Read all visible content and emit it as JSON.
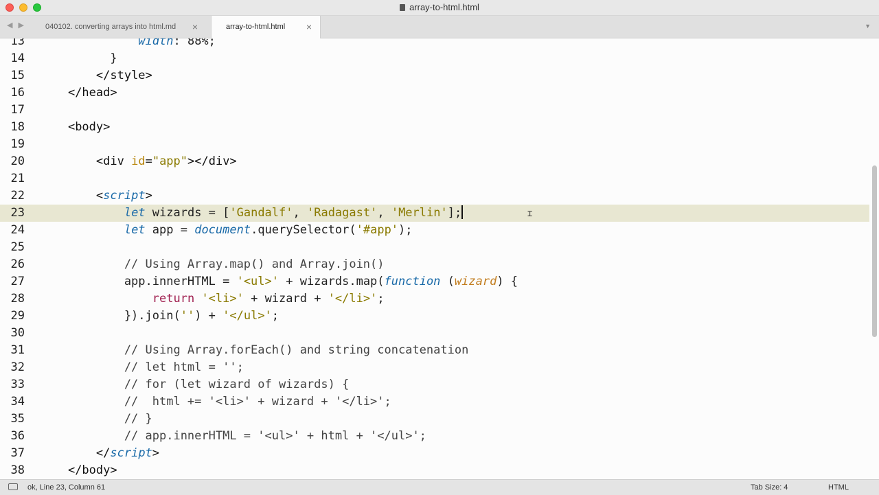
{
  "window": {
    "title": "array-to-html.html"
  },
  "tabs": [
    {
      "label": "040102. converting arrays into html.md",
      "active": false
    },
    {
      "label": "array-to-html.html",
      "active": true
    }
  ],
  "editor": {
    "lines": [
      13,
      14,
      15,
      16,
      17,
      18,
      19,
      20,
      21,
      22,
      23,
      24,
      25,
      26,
      27,
      28,
      29,
      30,
      31,
      32,
      33,
      34,
      35,
      36,
      37,
      38
    ],
    "active_line": 23
  },
  "status": {
    "text": "ok, Line 23, Column 61",
    "tab_size": "Tab Size: 4",
    "syntax": "HTML"
  },
  "colors": {
    "active_line": "#e8e7d2",
    "keyword": "#1a6aa8",
    "string": "#8a7a00",
    "attribute": "#b8860b"
  }
}
